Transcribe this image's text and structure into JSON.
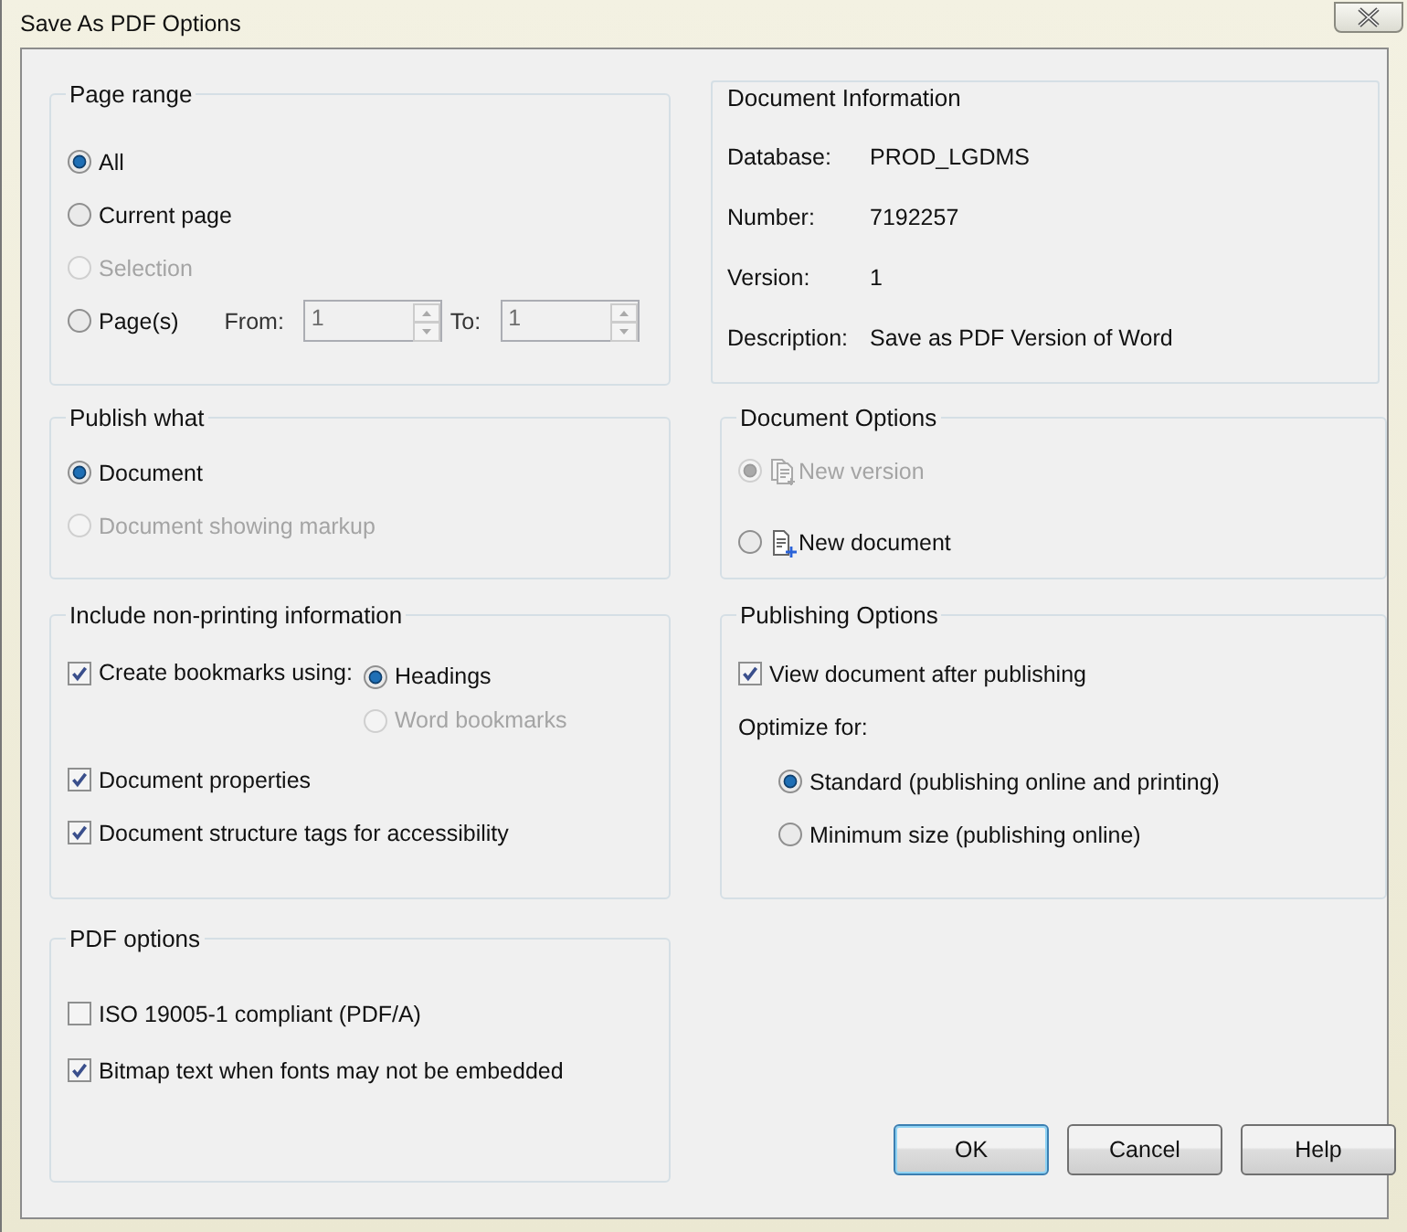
{
  "window": {
    "title": "Save As PDF Options"
  },
  "page_range": {
    "title": "Page range",
    "options": [
      {
        "label": "All",
        "selected": true,
        "disabled": false
      },
      {
        "label": "Current page",
        "selected": false,
        "disabled": false
      },
      {
        "label": "Selection",
        "selected": false,
        "disabled": true
      },
      {
        "label": "Page(s)",
        "selected": false,
        "disabled": false
      }
    ],
    "from": {
      "label": "From:",
      "value": "1",
      "disabled": true
    },
    "to": {
      "label": "To:",
      "value": "1",
      "disabled": true
    }
  },
  "document_information": {
    "title": "Document Information",
    "fields": [
      {
        "label": "Database:",
        "value": "PROD_LGDMS"
      },
      {
        "label": "Number:",
        "value": "7192257"
      },
      {
        "label": "Version:",
        "value": "1"
      },
      {
        "label": "Description:",
        "value": "Save as PDF Version of Word"
      }
    ]
  },
  "publish_what": {
    "title": "Publish what",
    "options": [
      {
        "label": "Document",
        "selected": true,
        "disabled": false
      },
      {
        "label": "Document showing markup",
        "selected": false,
        "disabled": true
      }
    ]
  },
  "document_options": {
    "title": "Document Options",
    "options": [
      {
        "label": "New version",
        "selected": true,
        "disabled": true
      },
      {
        "label": "New document",
        "selected": false,
        "disabled": false
      }
    ]
  },
  "non_printing": {
    "title": "Include non-printing information",
    "create_bookmarks": {
      "label": "Create bookmarks using:",
      "checked": true
    },
    "bookmark_sources": [
      {
        "label": "Headings",
        "selected": true,
        "disabled": false
      },
      {
        "label": "Word bookmarks",
        "selected": false,
        "disabled": true
      }
    ],
    "checkboxes": [
      {
        "label": "Document properties",
        "checked": true
      },
      {
        "label": "Document structure tags for accessibility",
        "checked": true
      }
    ]
  },
  "publishing_options": {
    "title": "Publishing Options",
    "checkboxes": [
      {
        "label": "View document after publishing",
        "checked": true
      }
    ],
    "optimize_label": "Optimize for:",
    "optimize": [
      {
        "label": "Standard (publishing online and printing)",
        "selected": true,
        "disabled": false
      },
      {
        "label": "Minimum size (publishing online)",
        "selected": false,
        "disabled": false
      }
    ]
  },
  "pdf_options": {
    "title": "PDF options",
    "checkboxes": [
      {
        "label": "ISO 19005-1 compliant (PDF/A)",
        "checked": false
      },
      {
        "label": "Bitmap text when fonts may not be embedded",
        "checked": true
      }
    ]
  },
  "buttons": [
    {
      "label": "OK",
      "default": true
    },
    {
      "label": "Cancel",
      "default": false
    },
    {
      "label": "Help",
      "default": false
    }
  ]
}
